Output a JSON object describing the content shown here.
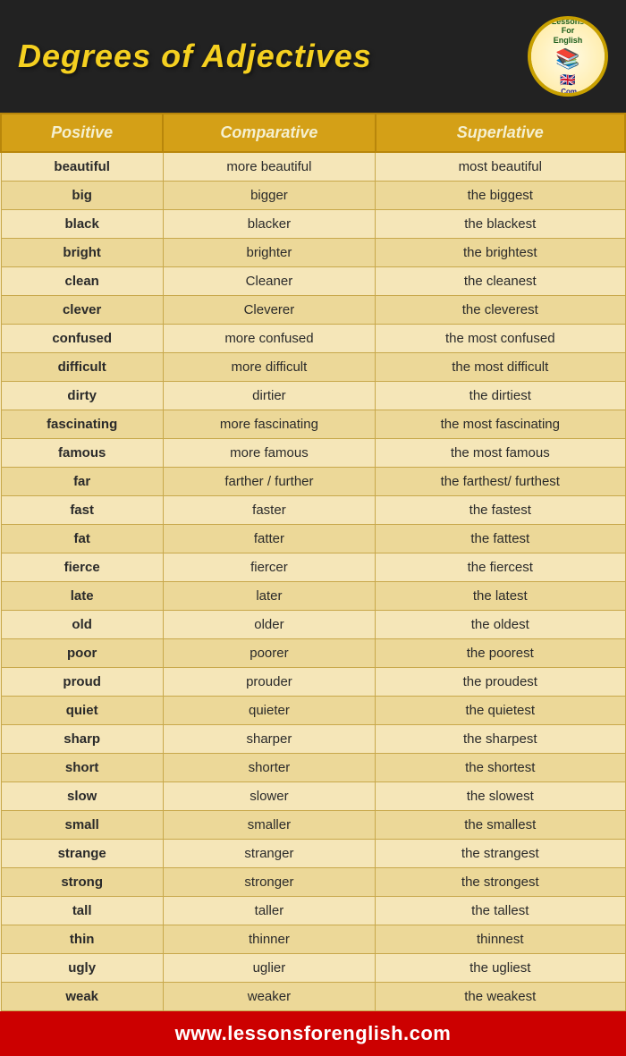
{
  "header": {
    "title": "Degrees of Adjectives"
  },
  "logo": {
    "text_top": "LessonsForEnglish",
    "text_bottom": ".Com",
    "books_icon": "📚",
    "flag_icon": "🇬🇧"
  },
  "table": {
    "columns": [
      "Positive",
      "Comparative",
      "Superlative"
    ],
    "rows": [
      [
        "beautiful",
        "more beautiful",
        "most beautiful"
      ],
      [
        "big",
        "bigger",
        "the biggest"
      ],
      [
        "black",
        "blacker",
        "the blackest"
      ],
      [
        "bright",
        "brighter",
        "the brightest"
      ],
      [
        "clean",
        "Cleaner",
        "the cleanest"
      ],
      [
        "clever",
        "Cleverer",
        "the cleverest"
      ],
      [
        "confused",
        "more confused",
        "the most confused"
      ],
      [
        "difficult",
        "more difficult",
        "the most difficult"
      ],
      [
        "dirty",
        "dirtier",
        "the dirtiest"
      ],
      [
        "fascinating",
        "more fascinating",
        "the most fascinating"
      ],
      [
        "famous",
        "more famous",
        "the most famous"
      ],
      [
        "far",
        "farther / further",
        "the farthest/ furthest"
      ],
      [
        "fast",
        "faster",
        "the fastest"
      ],
      [
        "fat",
        "fatter",
        "the fattest"
      ],
      [
        "fierce",
        "fiercer",
        "the fiercest"
      ],
      [
        "late",
        "later",
        "the latest"
      ],
      [
        "old",
        "older",
        "the oldest"
      ],
      [
        "poor",
        "poorer",
        "the poorest"
      ],
      [
        "proud",
        "prouder",
        "the proudest"
      ],
      [
        "quiet",
        "quieter",
        "the quietest"
      ],
      [
        "sharp",
        "sharper",
        "the sharpest"
      ],
      [
        "short",
        "shorter",
        "the shortest"
      ],
      [
        "slow",
        "slower",
        "the slowest"
      ],
      [
        "small",
        "smaller",
        "the smallest"
      ],
      [
        "strange",
        "stranger",
        "the strangest"
      ],
      [
        "strong",
        "stronger",
        "the strongest"
      ],
      [
        "tall",
        "taller",
        "the tallest"
      ],
      [
        "thin",
        "thinner",
        "thinnest"
      ],
      [
        "ugly",
        "uglier",
        "the ugliest"
      ],
      [
        "weak",
        "weaker",
        "the weakest"
      ]
    ]
  },
  "footer": {
    "url": "www.lessonsforenglish.com"
  }
}
